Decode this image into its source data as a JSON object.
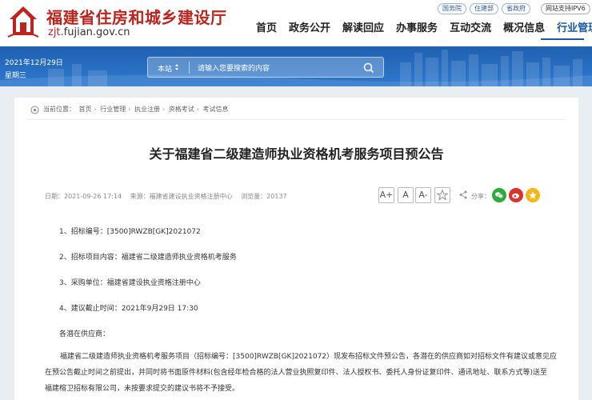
{
  "header": {
    "site_title": "福建省住房和城乡建设厅",
    "domain_prefix": "zjt",
    "domain_suffix": ".fujian.gov.cn",
    "top_links": [
      "国务院",
      "住建部",
      "省政府"
    ],
    "ipv6_label": "网站支持IPV6",
    "nav": [
      "首页",
      "政务公开",
      "解读回应",
      "办事服务",
      "互动交流",
      "概况信息",
      "行业管理"
    ],
    "active_nav": "行业管理"
  },
  "banner": {
    "date": "2021年12月29日",
    "weekday": "星期三",
    "search_scope": "本站",
    "search_placeholder": "请输入您要搜索的内容"
  },
  "breadcrumb": {
    "label": "当前位置：",
    "items": [
      "首页",
      "行业管理",
      "执业注册",
      "资格考试",
      "考试信息"
    ]
  },
  "article": {
    "title": "关于福建省二级建造师执业资格机考服务项目预公告",
    "date": "日期：2021-09-26 17:14",
    "source": "来源：福建省建设执业资格注册中心",
    "views": "浏览量：20137",
    "font_buttons": [
      "A+",
      "A",
      "A-"
    ],
    "share_label": "分享：",
    "item1": "1、招标编号：[3500]RWZB[GK]2021072",
    "item2": "2、招标项目内容：福建省二级建造师执业资格机考服务",
    "item3": "3、采购单位：福建省建设执业资格注册中心",
    "item4": "4、建议截止时间：2021年9月29日 17:30",
    "greeting": "各潜在供应商：",
    "paragraph_line1": "福建省二级建造师执业资格机考服务项目（招标编号：[3500]RWZB[GK]2021072）现发布招标文件预公告，各潜在的供应商如对招标文件有建议或意见应",
    "paragraph_line2": "在预公告截止时间之前提出，并同时将书面原件材料(包含经年检合格的法人营业执照复印件、法人授权书、委托人身份证复印件、通讯地址、联系方式等)送至",
    "paragraph_line3": "福建榕卫招标有限公司，未按要求提交的建议书将不予接受。"
  },
  "colors": {
    "brand_red": "#c0231c",
    "brand_blue": "#1c5aa7",
    "wechat_green": "#2aae3b",
    "weibo_red": "#e0302c",
    "qzone_yellow": "#f5b516"
  }
}
